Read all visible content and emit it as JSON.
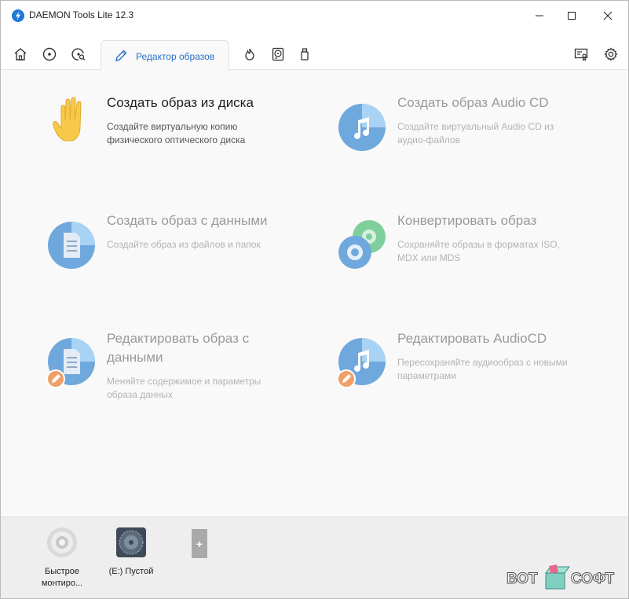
{
  "window": {
    "title": "DAEMON Tools Lite 12.3"
  },
  "tabs": {
    "icons": [
      "home-icon",
      "disc-icon",
      "disc-search-icon",
      "burn-icon",
      "virtual-hdd-icon",
      "usb-icon",
      "license-icon",
      "settings-icon"
    ],
    "active_label": "Редактор образов"
  },
  "cards": {
    "create_from_disc": {
      "title": "Создать образ из диска",
      "desc_line1": "Создайте виртуальную копию",
      "desc_line2": "физического оптического диска"
    },
    "create_audio_cd": {
      "title": "Создать образ Audio CD",
      "desc_line1": "Создайте виртуальный Audio CD из",
      "desc_line2": "аудио-файлов"
    },
    "create_data": {
      "title": "Создать образ с данными",
      "desc_line1": "Создайте образ из файлов и папок"
    },
    "convert": {
      "title": "Конвертировать образ",
      "desc_line1": "Сохраняйте образы в форматах ISO,",
      "desc_line2": "MDX или MDS"
    },
    "edit_data": {
      "title_line1": "Редактировать образ с",
      "title_line2": "данными",
      "desc_line1": "Меняйте содержимое и параметры",
      "desc_line2": "образа данных"
    },
    "edit_audio": {
      "title": "Редактировать AudioCD",
      "desc_line1": "Пересохраняйте аудиообраз с новыми",
      "desc_line2": "параметрами"
    }
  },
  "bottom": {
    "quick_mount_line1": "Быстрое",
    "quick_mount_line2": "монтиро...",
    "drive_label": "(E:) Пустой",
    "add_label": "+"
  },
  "watermark": {
    "left": "ВОТ",
    "right": "СОФТ"
  },
  "colors": {
    "accent": "#2a6fc9",
    "icon_blue": "#6fa8dc",
    "icon_light_blue": "#a9d3f5",
    "hand_yellow": "#f7c948",
    "edit_orange": "#f0a066",
    "convert_green": "#7fcf9c"
  }
}
